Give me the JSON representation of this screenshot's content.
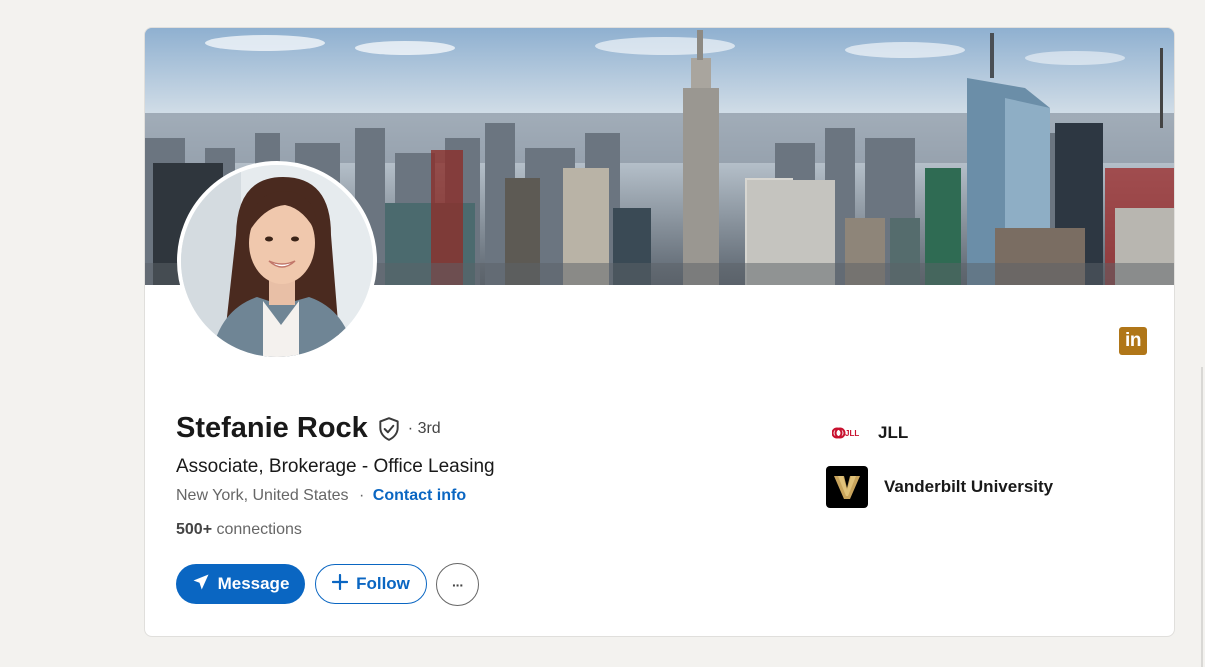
{
  "profile": {
    "name": "Stefanie Rock",
    "degree": "· 3rd",
    "headline": "Associate, Brokerage - Office Leasing",
    "location": "New York, United States",
    "separator": "·",
    "contact_label": "Contact info",
    "connections_count": "500+",
    "connections_label": "connections"
  },
  "actions": {
    "message_label": "Message",
    "follow_label": "Follow",
    "more_label": "···"
  },
  "brand": {
    "linkedin_badge": "in",
    "accent": "#0a66c2",
    "badge_color": "#b07618"
  },
  "organizations": [
    {
      "name": "JLL",
      "logo_text": "JLL",
      "icon": "jll-logo"
    },
    {
      "name": "Vanderbilt University",
      "icon": "vanderbilt-logo"
    }
  ],
  "icons": {
    "verified": "shield-check-icon",
    "message": "send-icon",
    "follow": "plus-icon",
    "more": "ellipsis-icon"
  }
}
